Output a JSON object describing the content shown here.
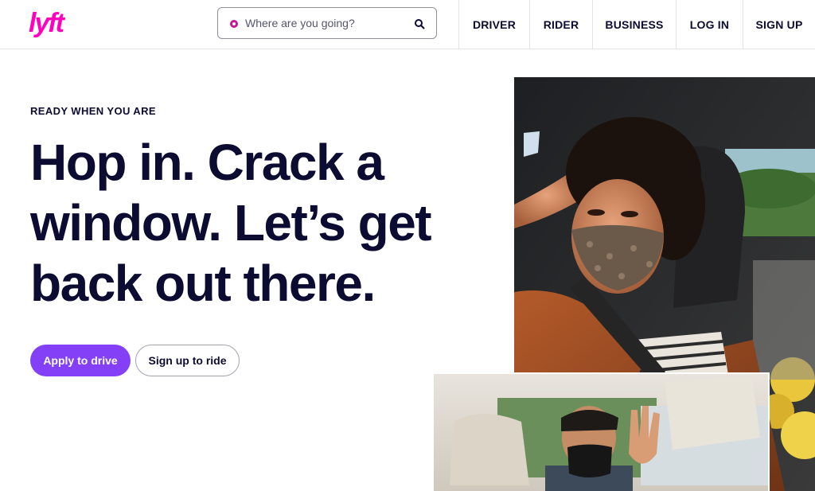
{
  "brand": {
    "name": "lyft",
    "color": "#ff00bf"
  },
  "search": {
    "placeholder": "Where are you going?"
  },
  "nav": {
    "driver": "DRIVER",
    "rider": "RIDER",
    "business": "BUSINESS",
    "login": "LOG IN",
    "signup": "SIGN UP"
  },
  "hero": {
    "eyebrow": "READY WHEN YOU ARE",
    "headline_lines": [
      "Hop in. Crack a",
      "window. Let’s get",
      "back out there."
    ],
    "primary_cta": "Apply to drive",
    "secondary_cta": "Sign up to ride"
  },
  "colors": {
    "primary": "#8440f6",
    "text": "#0c0b31",
    "pin": "#c5188f"
  }
}
